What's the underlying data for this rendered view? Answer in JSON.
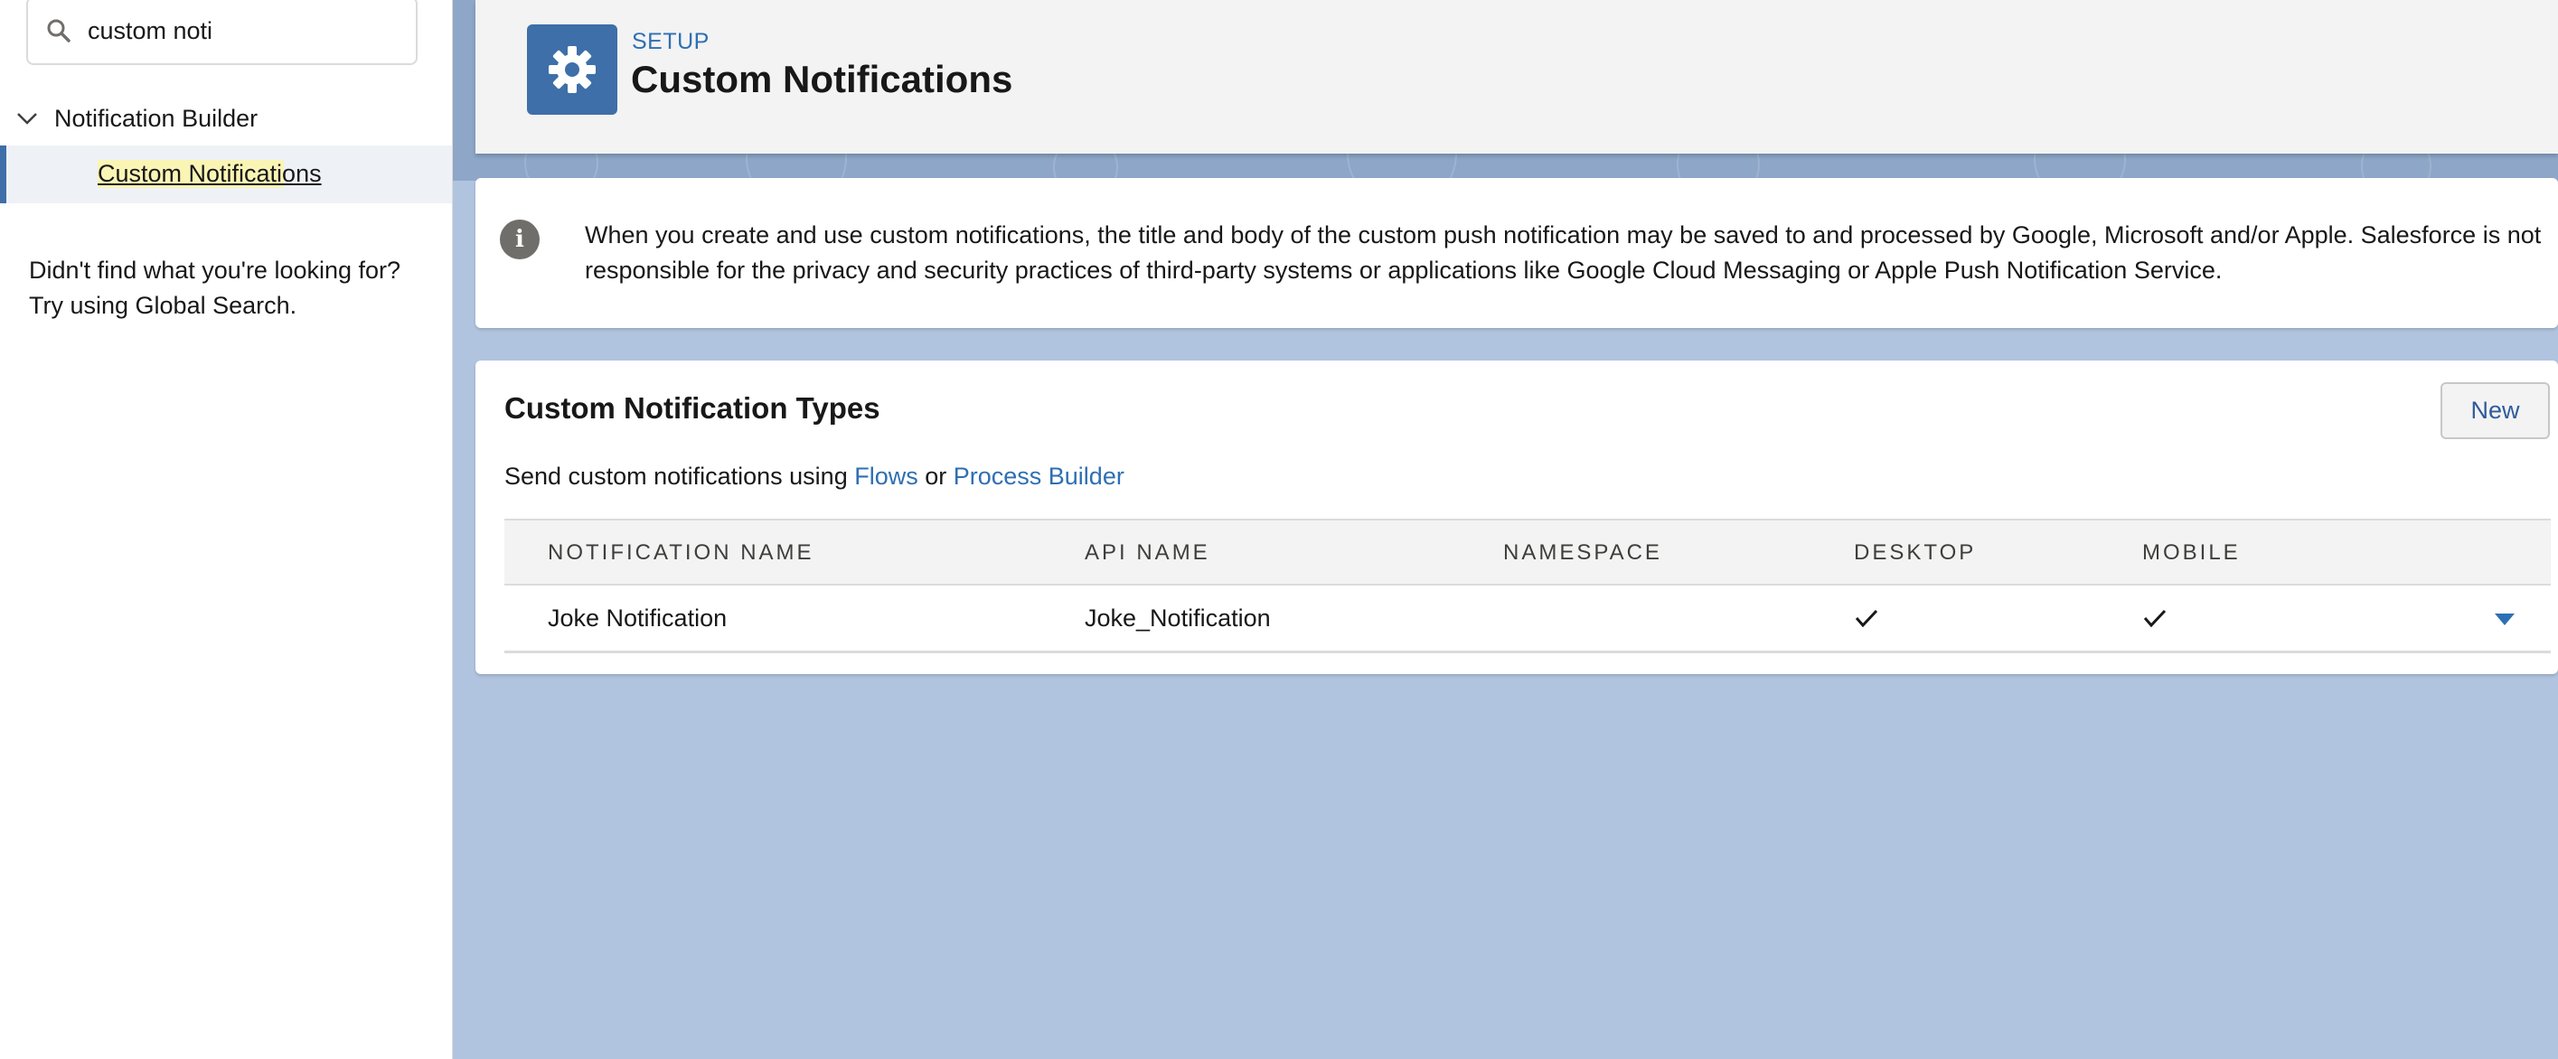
{
  "sidebar": {
    "search": {
      "value": "custom noti",
      "icon": "search-icon"
    },
    "group_label": "Notification Builder",
    "item_label": "Custom Notifications",
    "help_line1": "Didn't find what you're looking for?",
    "help_line2": "Try using Global Search."
  },
  "header": {
    "eyebrow": "SETUP",
    "title": "Custom Notifications",
    "icon": "gear-icon"
  },
  "info": {
    "message": "When you create and use custom notifications, the title and body of the custom push notification may be saved to and processed by Google, Microsoft and/or Apple. Salesforce is not responsible for the privacy and security practices of third-party systems or applications like Google Cloud Messaging or Apple Push Notification Service."
  },
  "types": {
    "title": "Custom Notification Types",
    "new_label": "New",
    "subtitle_prefix": "Send custom notifications using ",
    "link_flows": "Flows",
    "subtitle_or": " or ",
    "link_process_builder": "Process Builder",
    "columns": [
      "NOTIFICATION NAME",
      "API NAME",
      "NAMESPACE",
      "DESKTOP",
      "MOBILE"
    ],
    "rows": [
      {
        "name": "Joke Notification",
        "api_name": "Joke_Notification",
        "namespace": "",
        "desktop": true,
        "mobile": true
      }
    ]
  },
  "colors": {
    "accent": "#3e6fa8",
    "link": "#2e6fb3",
    "background": "#b0c4df",
    "highlight": "#fbf5b5"
  }
}
